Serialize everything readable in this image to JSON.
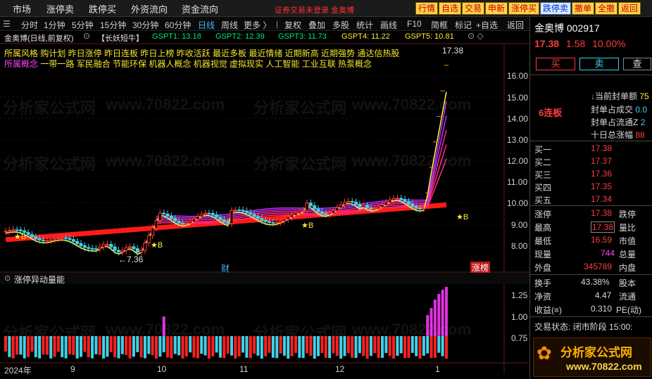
{
  "topbar": {
    "menu": [
      "市场",
      "涨停卖",
      "跌停买",
      "外资流向",
      "资金流向"
    ],
    "login_notice": "证券交易未登录 金奥博",
    "right_buttons": [
      {
        "label": "行情",
        "style": "yellow"
      },
      {
        "label": "自选",
        "style": "yellow"
      },
      {
        "label": "交易",
        "style": "yellow"
      },
      {
        "label": "申新",
        "style": "yellow"
      },
      {
        "label": "涨停买",
        "style": "yellow"
      },
      {
        "label": "跌停卖",
        "style": "blue"
      },
      {
        "label": "撤单",
        "style": "yellow"
      },
      {
        "label": "全撤",
        "style": "yellow"
      },
      {
        "label": "返回",
        "style": "yellow"
      }
    ]
  },
  "toolbar": {
    "periods": [
      "分时",
      "1分钟",
      "5分钟",
      "15分钟",
      "30分钟",
      "60分钟",
      "日线",
      "周线",
      "更多 〉"
    ],
    "active_period": "日线",
    "tools": [
      "复权",
      "叠加",
      "多股",
      "统计",
      "画线",
      "F10",
      "简框",
      "标记",
      "+自选",
      "返回"
    ]
  },
  "chart_header": {
    "title": "金奥博(日线,前复权)",
    "indicator": "【长妖短牛】",
    "gspt": [
      {
        "label": "GSPT1: 13.18",
        "color": "#00e676"
      },
      {
        "label": "GSPT2: 12.39",
        "color": "#00e676"
      },
      {
        "label": "GSPT3: 11.73",
        "color": "#00e676"
      },
      {
        "label": "GSPT4: 11.22",
        "color": "#ffeb3b"
      },
      {
        "label": "GSPT5: 10.81",
        "color": "#ffeb3b"
      }
    ]
  },
  "concepts": {
    "line1": "所属风格 购计划 昨日涨停 昨日连板 昨日上榜 昨收活跃 最近多板 最近情绪 近期新高 近期强势 通达信热股",
    "line2_prefix": "所属概念",
    "line2": "一带一路 军民融合 节能环保 机器人概念 机器视觉 虚拟现实 人工智能 工业互联 热泵概念"
  },
  "price_axis": [
    "16.00",
    "15.00",
    "14.00",
    "13.00",
    "12.00",
    "11.00",
    "10.00",
    "9.00",
    "8.00"
  ],
  "annotations": {
    "high": "17.38",
    "low": "7.36",
    "cai": "财",
    "zhangbang": "涨榜",
    "b_marker": "B"
  },
  "sub_chart": {
    "title": "涨停异动量能",
    "axis": [
      "1.25",
      "1.00",
      "0.75"
    ]
  },
  "x_axis": [
    "2024年",
    "9",
    "10",
    "11",
    "12",
    "1"
  ],
  "stock": {
    "name": "金奥博",
    "code": "002917",
    "price": "17.38",
    "change": "1.58",
    "pct": "10.00%",
    "buy_btn": "买",
    "sell_btn": "卖",
    "check_btn": "查"
  },
  "seal": {
    "streak": "6连板",
    "rows": [
      {
        "label": "当前封单额",
        "value": "75"
      },
      {
        "label": "封单占成交",
        "value": "0.0"
      },
      {
        "label": "封单占流通Z",
        "value": "2"
      },
      {
        "label": "十日总涨幅",
        "value": "88"
      }
    ]
  },
  "orderbook": [
    {
      "label": "买一",
      "price": "17.38"
    },
    {
      "label": "买二",
      "price": "17.37"
    },
    {
      "label": "买三",
      "price": "17.36"
    },
    {
      "label": "买四",
      "price": "17.35"
    },
    {
      "label": "买五",
      "price": "17.34"
    }
  ],
  "quote": [
    {
      "l1": "涨停",
      "v1": "17.38",
      "l2": "跌停"
    },
    {
      "l1": "最高",
      "v1": "17.38",
      "l2": "量比"
    },
    {
      "l1": "最低",
      "v1": "16.59",
      "l2": "市值"
    },
    {
      "l1": "现量",
      "v1": "744",
      "l2": "总量"
    },
    {
      "l1": "外盘",
      "v1": "345789",
      "l2": "内盘"
    },
    {
      "l1": "换手",
      "v1": "43.38%",
      "l2": "股本"
    },
    {
      "l1": "净资",
      "v1": "4.47",
      "l2": "流通"
    },
    {
      "l1": "收益(≡)",
      "v1": "0.310",
      "l2": "PE(动)"
    }
  ],
  "status": {
    "label": "交易状态:",
    "value": "闭市阶段",
    "time": "15:00:"
  },
  "watermark": {
    "site": "分析家公式网",
    "url": "www.70822.com"
  }
}
